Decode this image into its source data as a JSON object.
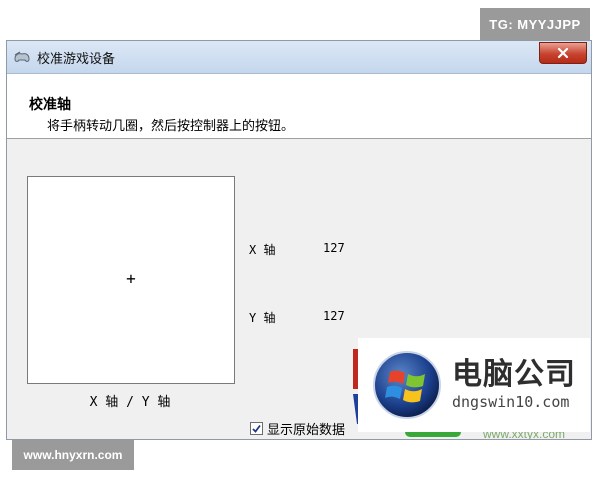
{
  "watermark_top": "TG: MYYJJPP",
  "watermark_bottom": "www.hnyxrn.com",
  "window": {
    "title": "校准游戏设备",
    "close_icon": "close-x-icon",
    "app_icon": "gamepad-icon"
  },
  "header": {
    "title": "校准轴",
    "instruction": "将手柄转动几圈，然后按控制器上的按钮。"
  },
  "axis_display": {
    "crosshair": "+",
    "caption": "X 轴 / Y 轴"
  },
  "axes": [
    {
      "label": "X 轴",
      "value": "127"
    },
    {
      "label": "Y 轴",
      "value": "127"
    }
  ],
  "raw_data_checkbox": {
    "label": "显示原始数据",
    "checked": true
  },
  "overlay_logo": {
    "brand": "电脑公司",
    "domain": "dngswin10.com",
    "icon": "windows-logo-icon"
  },
  "background_site_text": "www.xxtyx.com"
}
